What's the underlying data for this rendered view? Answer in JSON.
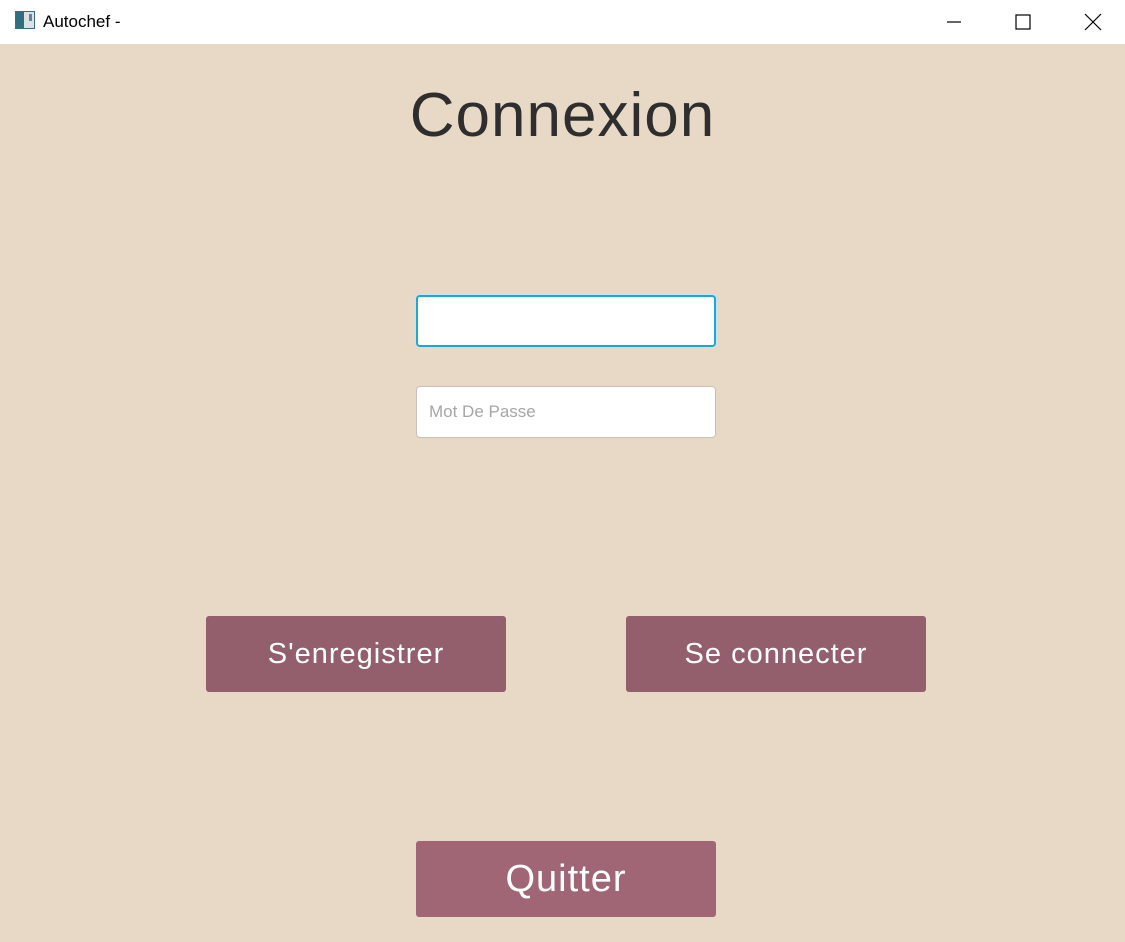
{
  "window": {
    "title": "Autochef -",
    "icon": "app-window-icon",
    "controls": {
      "minimize_icon": "minimize-icon",
      "maximize_icon": "maximize-icon",
      "close_icon": "close-icon"
    }
  },
  "page": {
    "heading": "Connexion"
  },
  "form": {
    "username": {
      "value": "",
      "placeholder": ""
    },
    "password": {
      "value": "",
      "placeholder": "Mot De Passe"
    }
  },
  "buttons": {
    "register_label": "S'enregistrer",
    "login_label": "Se connecter",
    "quit_label": "Quitter"
  },
  "colors": {
    "background": "#e8d8c6",
    "button": "#935f6d",
    "quit_button": "#a06675",
    "focus_border": "#1fa6d8"
  }
}
